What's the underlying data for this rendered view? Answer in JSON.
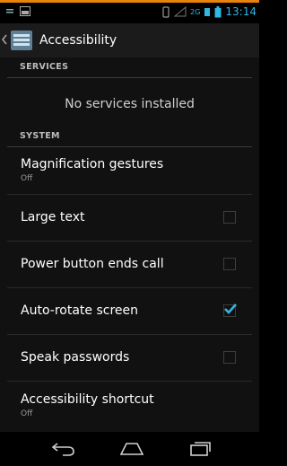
{
  "status_bar": {
    "time": "13:14",
    "network_indicator": "2G",
    "icons": [
      "notification-icon",
      "screenshot-icon",
      "vibrate-icon",
      "signal-icon",
      "data-icon",
      "battery-icon"
    ]
  },
  "action_bar": {
    "title": "Accessibility",
    "icon": "accessibility-settings-icon"
  },
  "sections": [
    {
      "header": "SERVICES",
      "empty_message": "No services installed"
    },
    {
      "header": "SYSTEM",
      "items": [
        {
          "title": "Magnification gestures",
          "summary": "Off",
          "type": "summary"
        },
        {
          "title": "Large text",
          "type": "checkbox",
          "checked": false
        },
        {
          "title": "Power button ends call",
          "type": "checkbox",
          "checked": false
        },
        {
          "title": "Auto-rotate screen",
          "type": "checkbox",
          "checked": true
        },
        {
          "title": "Speak passwords",
          "type": "checkbox",
          "checked": false
        },
        {
          "title": "Accessibility shortcut",
          "summary": "Off",
          "type": "summary"
        }
      ]
    }
  ],
  "nav_bar": {
    "buttons": [
      "back-icon",
      "home-icon",
      "recents-icon"
    ]
  },
  "colors": {
    "accent": "#33b5e5",
    "background": "#111111",
    "status_accent": "#e8820c"
  }
}
